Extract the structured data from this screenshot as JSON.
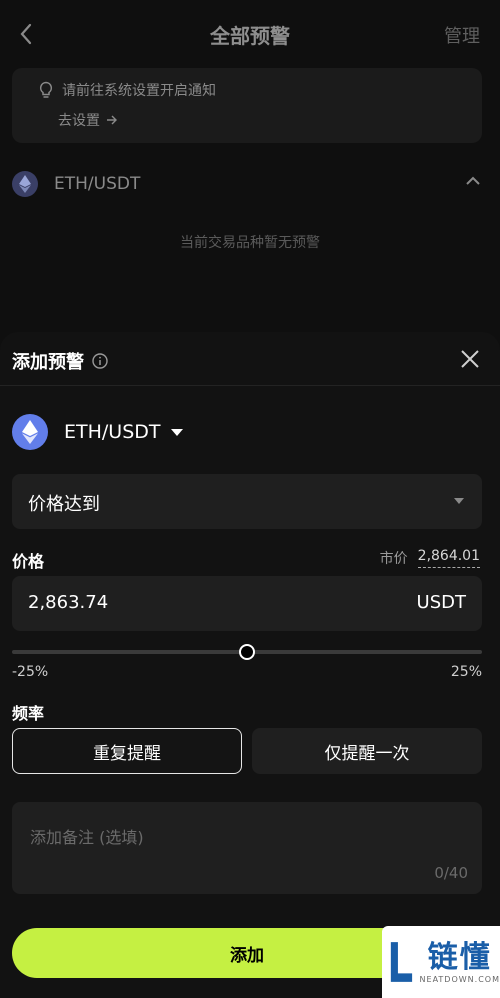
{
  "header": {
    "title": "全部预警",
    "manage": "管理"
  },
  "notice": {
    "message": "请前往系统设置开启通知",
    "link": "去设置"
  },
  "list": {
    "pair": "ETH/USDT",
    "empty": "当前交易品种暂无预警"
  },
  "sheet": {
    "title": "添加预警",
    "pair": "ETH/USDT",
    "condition": "价格达到",
    "price_label": "价格",
    "market_label": "市价",
    "market_value": "2,864.01",
    "price_value": "2,863.74",
    "unit": "USDT",
    "slider_min": "-25%",
    "slider_max": "25%",
    "slider_position": 0.5,
    "frequency_label": "频率",
    "freq_repeat": "重复提醒",
    "freq_once": "仅提醒一次",
    "note_placeholder": "添加备注 (选填)",
    "note_count": "0/40",
    "add_button": "添加"
  },
  "watermark": {
    "cn": "链懂",
    "en": "NEATDOWN.COM"
  },
  "colors": {
    "accent": "#c5f042",
    "eth": "#627eea"
  }
}
